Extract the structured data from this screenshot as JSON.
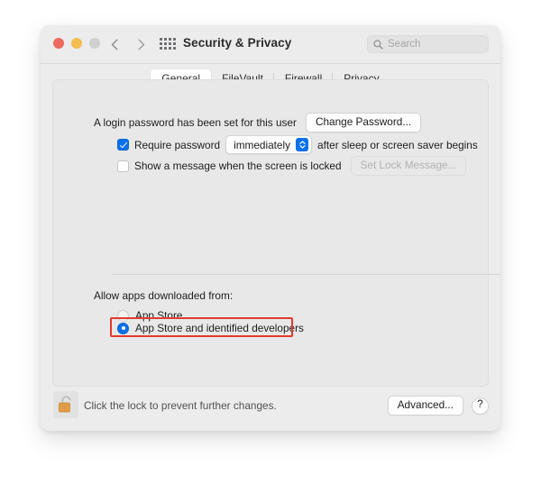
{
  "window": {
    "title": "Security & Privacy",
    "traffic_lights": [
      "close-button",
      "minimize-button",
      "zoom-button"
    ],
    "nav": {
      "back": "back-chevron",
      "forward": "forward-chevron"
    },
    "show_all_icon": "grid-apps-icon"
  },
  "search": {
    "placeholder": "Search",
    "value": "",
    "icon": "search-icon"
  },
  "tabs": [
    {
      "label": "General",
      "selected": true
    },
    {
      "label": "FileVault",
      "selected": false
    },
    {
      "label": "Firewall",
      "selected": false
    },
    {
      "label": "Privacy",
      "selected": false
    }
  ],
  "general": {
    "password_status": "A login password has been set for this user",
    "change_password_button": "Change Password...",
    "require_password": {
      "checked": true,
      "label_before": "Require password",
      "interval_value": "immediately",
      "label_after": "after sleep or screen saver begins"
    },
    "lock_message": {
      "checked": false,
      "label": "Show a message when the screen is locked",
      "button": "Set Lock Message...",
      "button_disabled": true
    },
    "allow_apps": {
      "heading": "Allow apps downloaded from:",
      "options": [
        {
          "label": "App Store",
          "selected": false
        },
        {
          "label": "App Store and identified developers",
          "selected": true
        }
      ],
      "highlight_color": "#e23b2e"
    }
  },
  "footer": {
    "lock_icon": "unlocked-padlock-icon",
    "lock_text": "Click the lock to prevent further changes.",
    "advanced_button": "Advanced...",
    "help_button": "?"
  },
  "colors": {
    "accent": "#0a71e8",
    "window_bg": "#ececec",
    "content_bg": "#e8e8e8",
    "annotation": "#e23b2e"
  }
}
